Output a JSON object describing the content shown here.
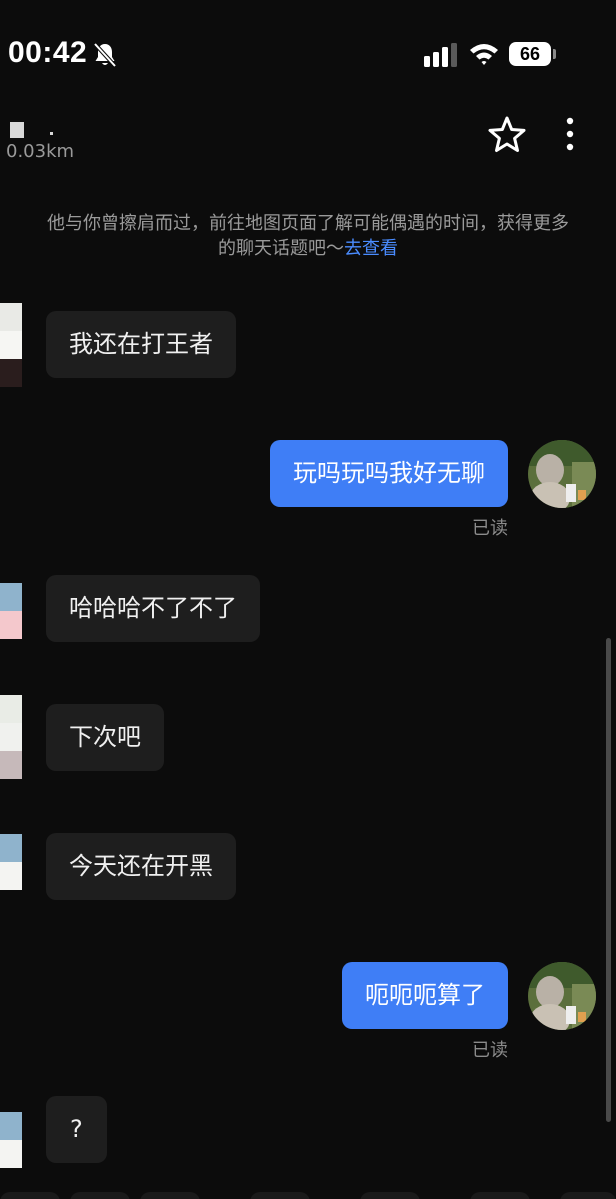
{
  "status_bar": {
    "time": "00:42",
    "battery": "66",
    "icons": [
      "bell-muted-icon",
      "signal-icon",
      "wifi-icon",
      "battery-icon"
    ]
  },
  "header": {
    "distance": "0.03km",
    "icons": [
      "star-icon",
      "more-vertical-icon"
    ]
  },
  "system_notice": {
    "text": "他与你曾擦肩而过，前往地图页面了解可能偶遇的时间，获得更多的聊天话题吧～",
    "link": "去查看"
  },
  "messages": [
    {
      "direction": "in",
      "text": "我还在打王者"
    },
    {
      "direction": "out",
      "text": "玩吗玩吗我好无聊",
      "status": "已读"
    },
    {
      "direction": "in",
      "text": "哈哈哈不了不了"
    },
    {
      "direction": "in",
      "text": "下次吧"
    },
    {
      "direction": "in",
      "text": "今天还在开黑"
    },
    {
      "direction": "out",
      "text": "呃呃呃算了",
      "status": "已读"
    },
    {
      "direction": "in",
      "text": "?"
    }
  ],
  "colors": {
    "background": "#0c0c0c",
    "incoming_bubble": "#1e1e1e",
    "outgoing_bubble": "#3f7ef6",
    "link": "#4a8cff",
    "muted_text": "#9a9a9a"
  }
}
